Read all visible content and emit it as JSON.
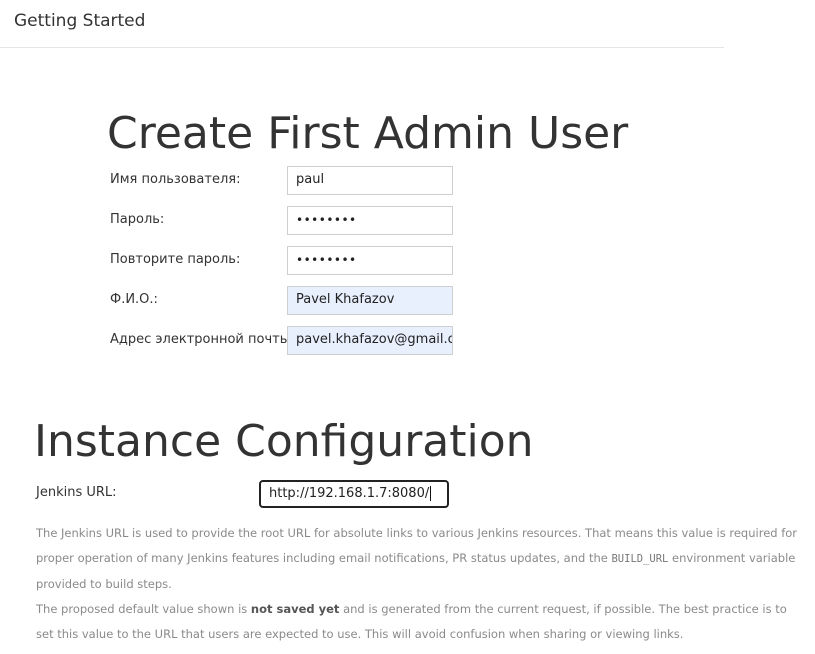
{
  "header": {
    "title": "Getting Started"
  },
  "admin": {
    "heading": "Create First Admin User",
    "fields": {
      "username": {
        "label": "Имя пользователя:",
        "value": "paul"
      },
      "password": {
        "label": "Пароль:",
        "value": "••••••••"
      },
      "password_confirm": {
        "label": "Повторите пароль:",
        "value": "••••••••"
      },
      "full_name": {
        "label": "Ф.И.О.:",
        "value": "Pavel Khafazov"
      },
      "email": {
        "label": "Адрес электронной почты:",
        "value": "pavel.khafazov@gmail.c"
      }
    }
  },
  "instance": {
    "heading": "Instance Configuration",
    "url_label": "Jenkins URL:",
    "url_value": "http://192.168.1.7:8080/",
    "help": {
      "p1_before": "The Jenkins URL is used to provide the root URL for absolute links to various Jenkins resources. That means this value is required for proper operation of many Jenkins features including email notifications, PR status updates, and the ",
      "p1_code": "BUILD_URL",
      "p1_after": " environment variable provided to build steps.",
      "p2_before": "The proposed default value shown is ",
      "p2_bold": "not saved yet",
      "p2_after": " and is generated from the current request, if possible. The best practice is to set this value to the URL that users are expected to use. This will avoid confusion when sharing or viewing links."
    }
  },
  "colors": {
    "autofill_bg": "#e8f0fe",
    "help_text": "#8a8a8a",
    "heading": "#333333"
  }
}
